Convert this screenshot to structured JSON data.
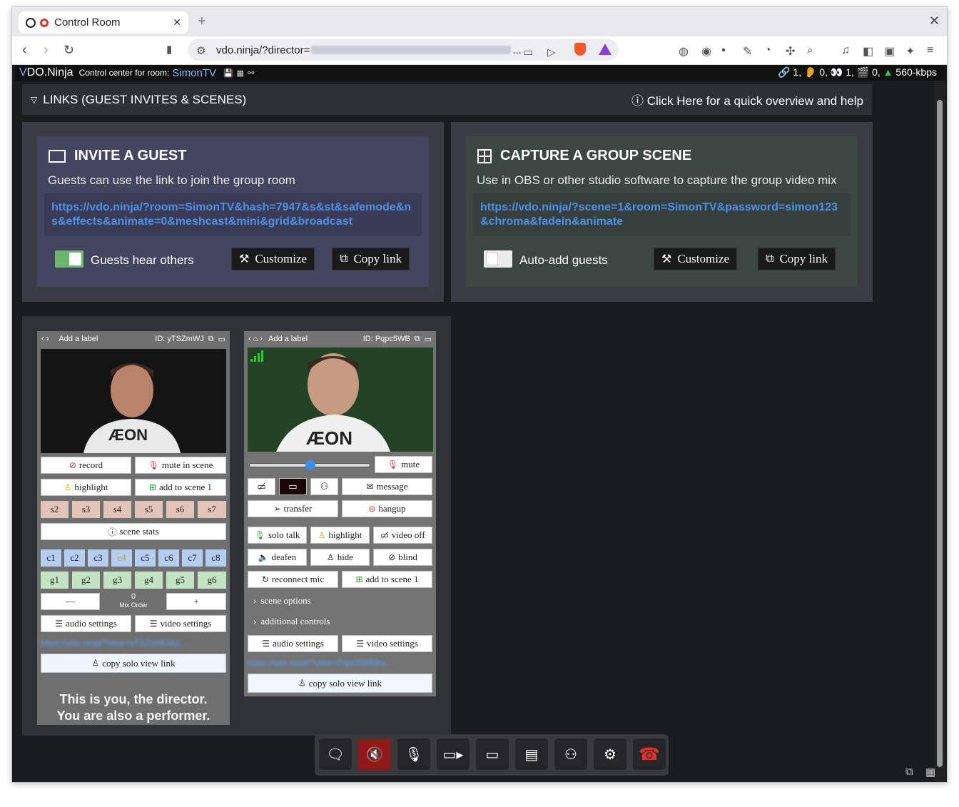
{
  "browser": {
    "tab_title": "Control Room",
    "url_prefix": "vdo.ninja/?director=",
    "url_suffix": "..."
  },
  "app": {
    "brand_v": "V",
    "brand_rest": "DO.Ninja",
    "control_center": "Control center for room:",
    "room_name": "SimonTV",
    "stats": "🔗 1, 👂 0, 👀 1, 🎬 0,",
    "bitrate": "560-kbps"
  },
  "links_bar": {
    "title": "LINKS (GUEST INVITES & SCENES)",
    "help": "Click Here for a quick overview and help"
  },
  "invite": {
    "title": "INVITE A GUEST",
    "subtitle": "Guests can use the link to join the group room",
    "link": "https://vdo.ninja/?room=SimonTV&hash=7947&s&st&safemode&ns&effects&animate=0&meshcast&mini&grid&broadcast",
    "toggle_label": "Guests hear others",
    "toggle_on": true,
    "customize": "Customize",
    "copy": "Copy link"
  },
  "capture": {
    "title": "CAPTURE A GROUP SCENE",
    "subtitle": "Use in OBS or other studio software to capture the group video mix",
    "link": "https://vdo.ninja/?scene=1&room=SimonTV&password=simon123&chroma&fadein&animate",
    "toggle_label": "Auto-add guests",
    "toggle_on": false,
    "customize": "Customize",
    "copy": "Copy link"
  },
  "guest1": {
    "label": "Add a label",
    "id": "ID: yTSZmWJ",
    "record": "record",
    "mute_scene": "mute in scene",
    "highlight": "highlight",
    "add_scene": "add to scene 1",
    "scenes": [
      "s2",
      "s3",
      "s4",
      "s5",
      "s6",
      "s7"
    ],
    "scene_stats": "scene stats",
    "channels": [
      "c1",
      "c2",
      "c3",
      "c4",
      "c5",
      "c6",
      "c7",
      "c8"
    ],
    "groups": [
      "g1",
      "g2",
      "g3",
      "g4",
      "g5",
      "g6"
    ],
    "minus": "—",
    "mix_value": "0",
    "mix_label": "Mix Order",
    "plus": "+",
    "audio_settings": "audio settings",
    "video_settings": "video settings",
    "solo_link": "https://vdo.ninja/?view=yTSZmWJ&s...",
    "copy_solo": "copy solo view link",
    "director_note_1": "This is you, the director.",
    "director_note_2": "You are also a performer."
  },
  "guest2": {
    "label": "Add a label",
    "id": "ID: Pqpc5WB",
    "mute": "mute",
    "volume": 0.5,
    "message": "message",
    "transfer": "transfer",
    "hangup": "hangup",
    "solo_talk": "solo talk",
    "highlight": "highlight",
    "video_off": "video off",
    "deafen": "deafen",
    "hide": "hide",
    "blind": "blind",
    "reconnect": "reconnect mic",
    "add_scene": "add to scene 1",
    "scene_options": "scene options",
    "additional": "additional controls",
    "audio_settings": "audio settings",
    "video_settings": "video settings",
    "solo_link": "https://vdo.ninja/?view=Pqpc5WB&s...",
    "copy_solo": "copy solo view link"
  },
  "colors": {
    "accent_link": "#4f8fe8",
    "invite_bg": "#434561",
    "capture_bg": "#3c4744",
    "toggle_on": "#6db66d",
    "hangup_red": "#e0342f"
  }
}
